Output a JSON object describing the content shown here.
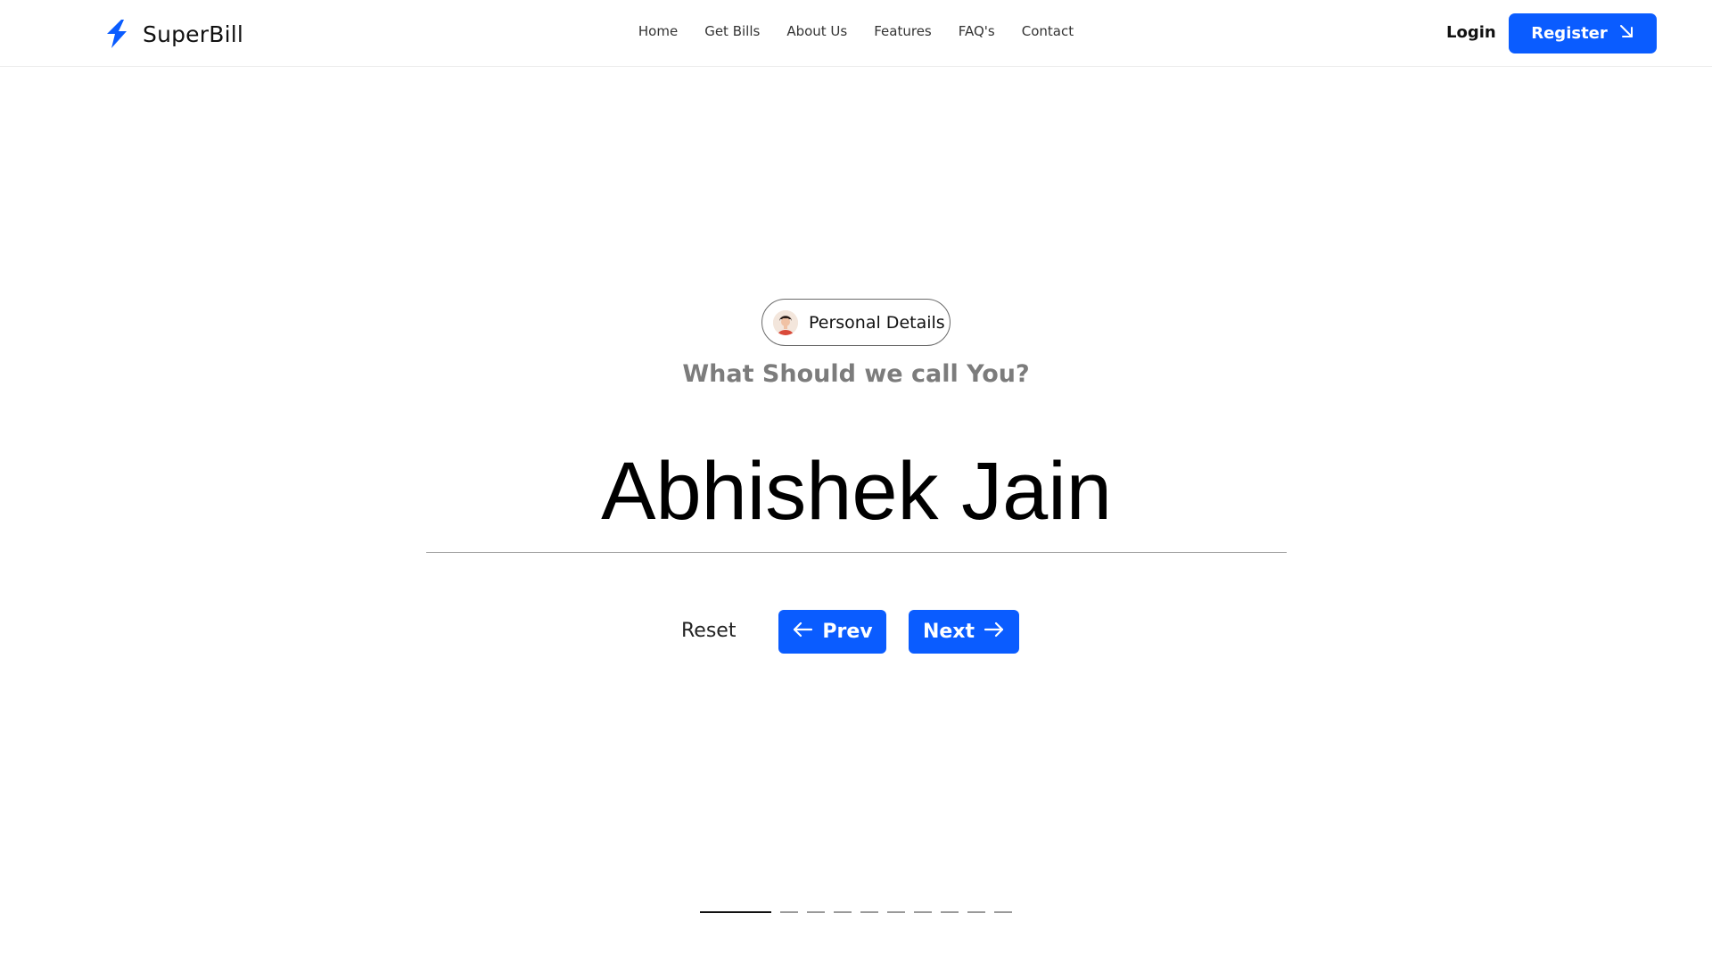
{
  "header": {
    "brand": "SuperBill",
    "nav": [
      "Home",
      "Get Bills",
      "About Us",
      "Features",
      "FAQ's",
      "Contact"
    ],
    "login": "Login",
    "register": "Register"
  },
  "step": {
    "pill_label": "Personal Details",
    "question": "What Should we call You?",
    "name_value": "Abhishek Jain"
  },
  "actions": {
    "reset": "Reset",
    "prev": "Prev",
    "next": "Next"
  },
  "progress": {
    "current_step": 1,
    "total_steps": 10
  },
  "colors": {
    "accent": "#0a5cff",
    "question_text": "#7c7c7c"
  },
  "icons": {
    "logo": "lightning-bolt-icon",
    "register": "arrow-down-right-icon",
    "prev": "arrow-left-icon",
    "next": "arrow-right-icon",
    "avatar": "user-avatar"
  }
}
